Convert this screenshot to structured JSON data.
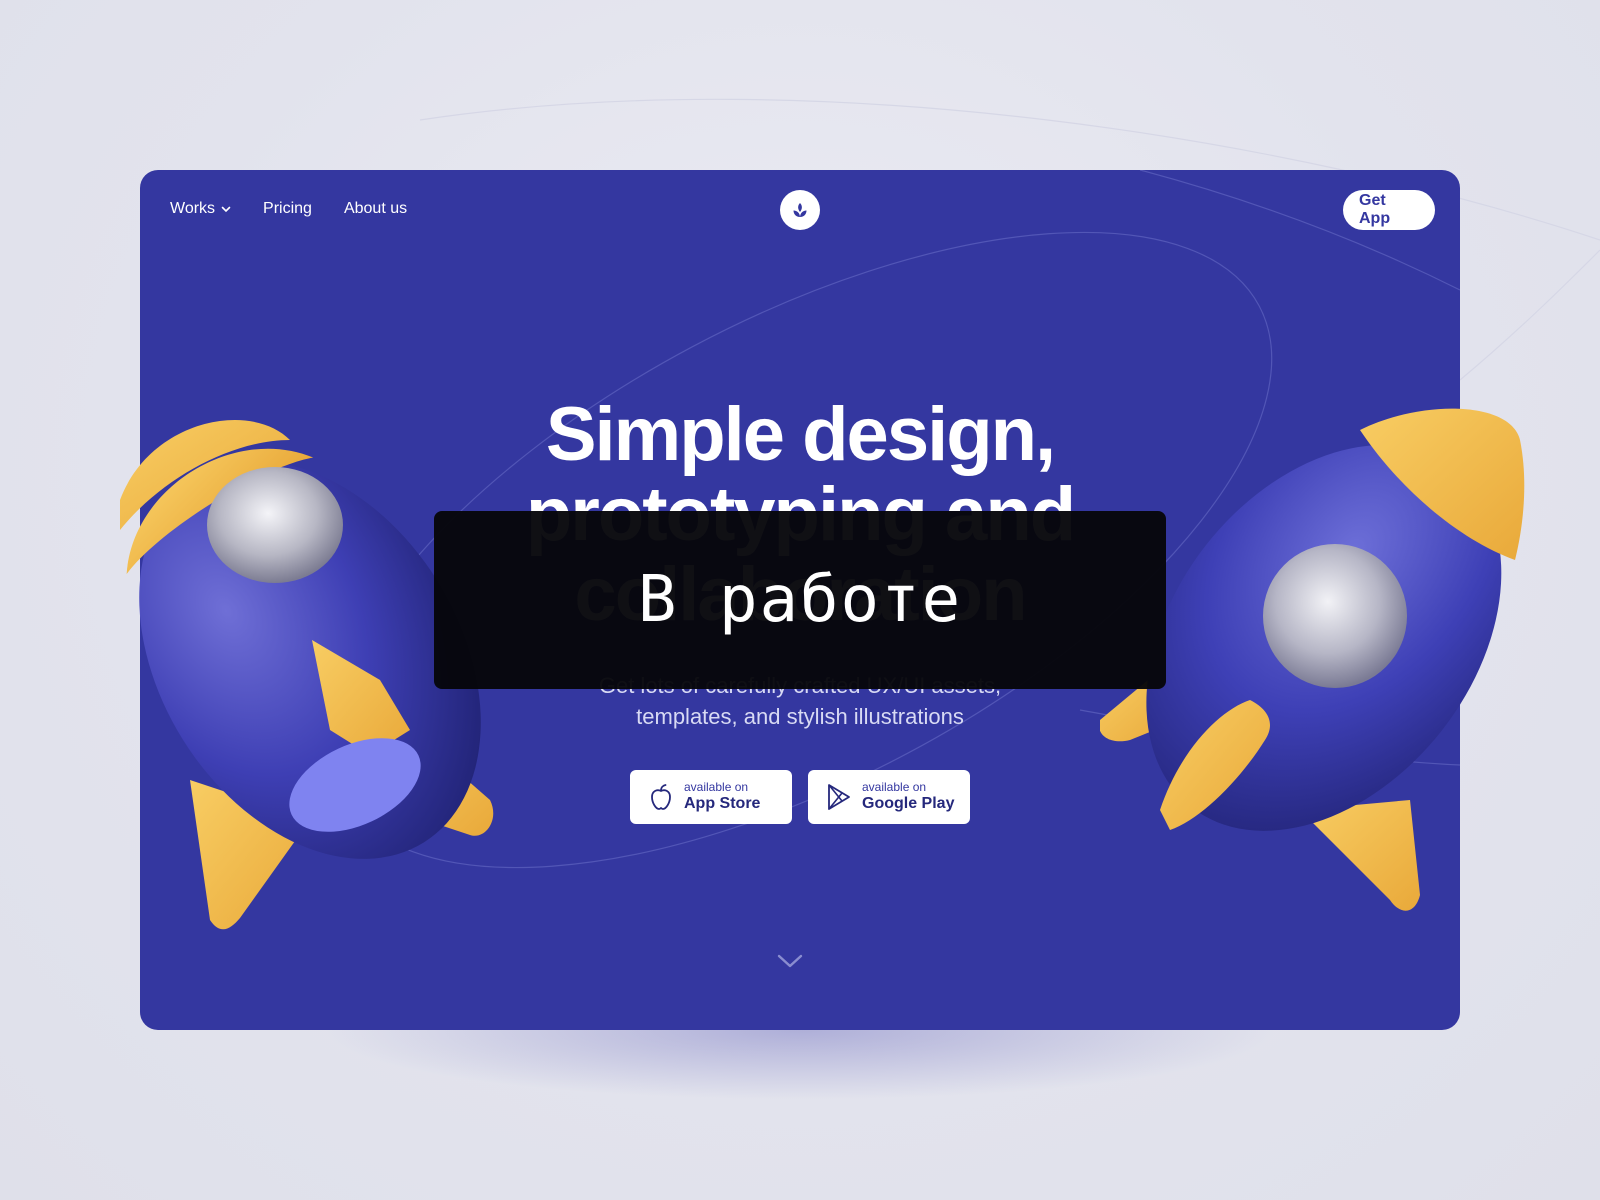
{
  "nav": {
    "items": [
      {
        "label": "Works",
        "has_dropdown": true
      },
      {
        "label": "Pricing"
      },
      {
        "label": "About us"
      }
    ],
    "logo_icon": "sprout-icon",
    "cta_label": "Get App"
  },
  "hero": {
    "headline_lines": [
      "Simple design,",
      "prototyping and",
      "collaboration"
    ],
    "subtitle_lines": [
      "Get lots of carefully crafted UX/UI assets,",
      "templates, and stylish illustrations"
    ],
    "stores": [
      {
        "small": "available on",
        "big": "App Store",
        "icon": "apple-icon"
      },
      {
        "small": "available on",
        "big": "Google Play",
        "icon": "google-play-icon"
      }
    ],
    "scroll_icon": "chevron-down-icon"
  },
  "overlay": {
    "label": "В работе"
  },
  "colors": {
    "card": "#3437a0",
    "rocket_body": "#3a3db0",
    "rocket_fin": "#f2b94a",
    "page_bg": "#e3e4ee"
  }
}
